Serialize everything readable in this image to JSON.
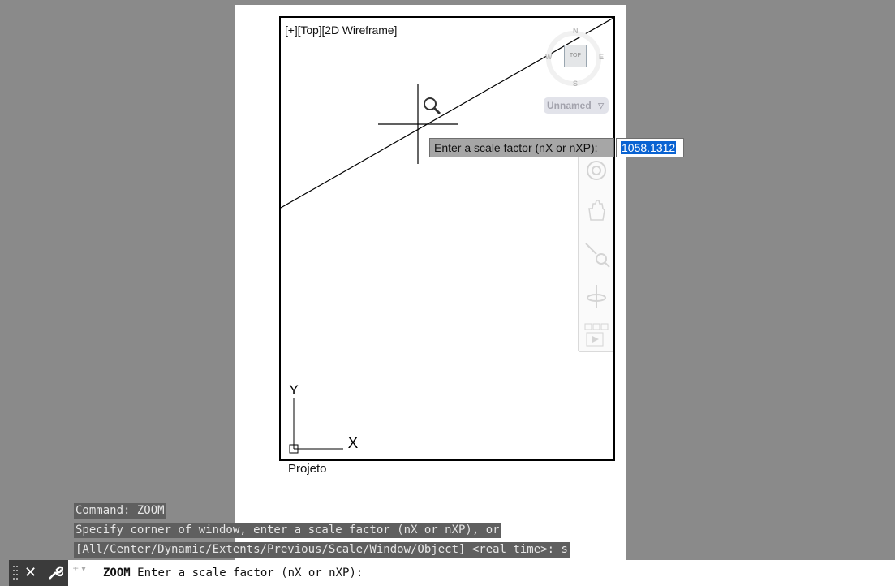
{
  "viewport": {
    "label": "[+][Top][2D Wireframe]",
    "viewcube": {
      "north": "N",
      "south": "S",
      "east": "E",
      "west": "W",
      "face": "TOP"
    },
    "ucs_label": "Unnamed"
  },
  "dynamic_input": {
    "prompt": "Enter a scale factor (nX or nXP):",
    "value": "1058.1312"
  },
  "ucs_icon": {
    "x_label": "X",
    "y_label": "Y"
  },
  "layout": {
    "name": "Projeto"
  },
  "command_history": [
    "Command: ZOOM",
    "Specify corner of window, enter a scale factor (nX or nXP), or",
    "[All/Center/Dynamic/Extents/Previous/Scale/Window/Object] <real time>: s"
  ],
  "command_line": {
    "command": "ZOOM",
    "prompt": "Enter a scale factor (nX or nXP):"
  },
  "icons": [
    "search-icon",
    "pan-icon",
    "zoom-extents-icon",
    "orbit-icon",
    "showmotion-icon",
    "close-icon",
    "wrench-icon"
  ],
  "colors": {
    "background": "#8a8a8a",
    "highlight": "#0a63d2",
    "history_bg": "#5f5f5f"
  }
}
